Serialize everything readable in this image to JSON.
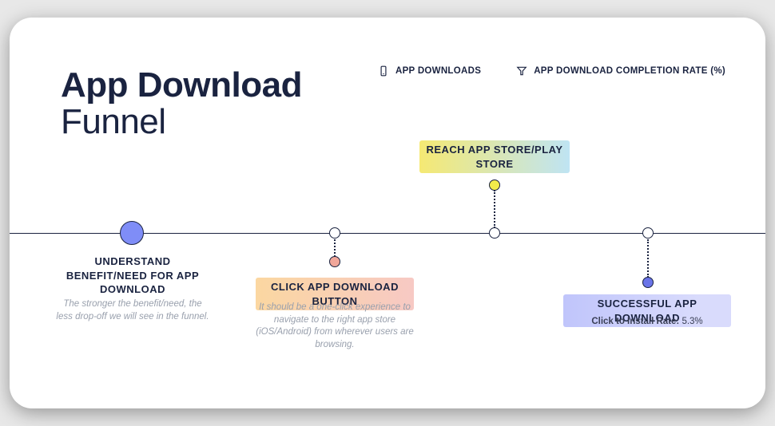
{
  "header": {
    "title_bold": "App Download",
    "title_light": "Funnel"
  },
  "metrics": [
    {
      "id": "app-downloads",
      "icon": "phone-icon",
      "label": "APP DOWNLOADS"
    },
    {
      "id": "completion-rate",
      "icon": "funnel-icon",
      "label": "APP DOWNLOAD COMPLETION RATE (%)"
    }
  ],
  "stages": {
    "s1": {
      "title": "UNDERSTAND BENEFIT/NEED FOR APP DOWNLOAD",
      "desc": "The stronger the benefit/need, the less drop-off we will see in the funnel."
    },
    "s2": {
      "title": "CLICK APP DOWNLOAD BUTTON",
      "desc": "It should be a one-click experience to navigate to the right app store (iOS/Android) from wherever users are browsing."
    },
    "s3": {
      "title": "REACH APP STORE/PLAY STORE"
    },
    "s4": {
      "title": "SUCCESSFUL APP DOWNLOAD",
      "rate_label": "Click to Install Rate: ",
      "rate_value": "5.3%"
    }
  }
}
